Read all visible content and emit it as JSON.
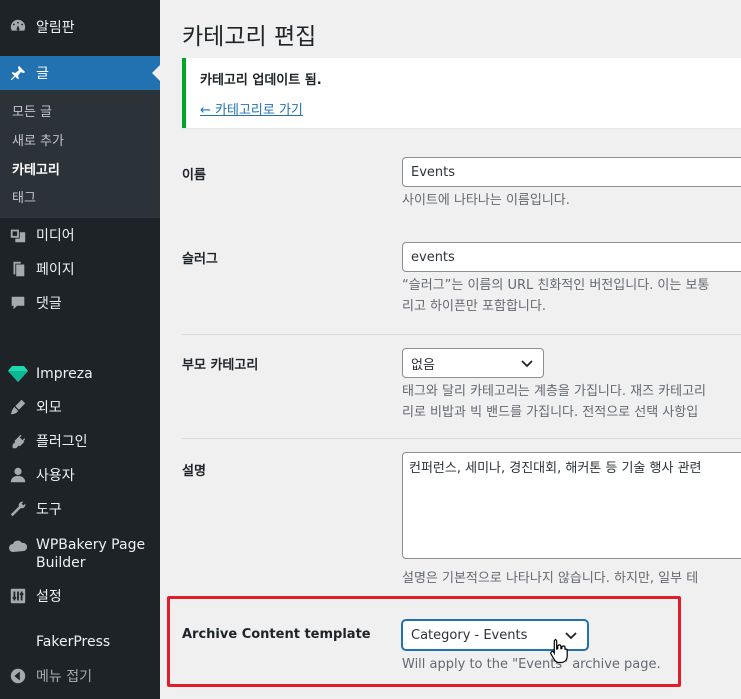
{
  "sidebar": {
    "items": [
      {
        "label": "알림판",
        "icon": "dashboard-icon"
      },
      {
        "label": "글",
        "icon": "pushpin-icon",
        "active": true
      },
      {
        "label": "미디어",
        "icon": "media-icon"
      },
      {
        "label": "페이지",
        "icon": "page-icon"
      },
      {
        "label": "댓글",
        "icon": "comment-icon"
      },
      {
        "label": "Impreza",
        "icon": "diamond-icon"
      },
      {
        "label": "외모",
        "icon": "brush-icon"
      },
      {
        "label": "플러그인",
        "icon": "plugin-icon"
      },
      {
        "label": "사용자",
        "icon": "user-icon"
      },
      {
        "label": "도구",
        "icon": "wrench-icon"
      },
      {
        "label": "WPBakery Page",
        "label2": "Builder",
        "icon": "cloud-icon"
      },
      {
        "label": "설정",
        "icon": "settings-icon"
      },
      {
        "label": "FakerPress",
        "icon": ""
      },
      {
        "label": "메뉴 접기",
        "icon": "collapse-icon"
      }
    ],
    "submenu": [
      "모든 글",
      "새로 추가",
      "카테고리",
      "태그"
    ]
  },
  "page": {
    "title": "카테고리 편집",
    "notice": {
      "message": "카테고리 업데이트 됨.",
      "back_link": "← 카테고리로 가기"
    }
  },
  "form": {
    "name": {
      "label": "이름",
      "value": "Events",
      "desc": "사이트에 나타나는 이름입니다."
    },
    "slug": {
      "label": "슬러그",
      "value": "events",
      "desc1": "“슬러그”는 이름의 URL 친화적인 버전입니다. 이는 보통",
      "desc2": "리고 하이픈만 포함합니다."
    },
    "parent": {
      "label": "부모 카테고리",
      "value": "없음",
      "desc1": "태그와 달리 카테고리는 계층을 가집니다. 재즈 카테고리",
      "desc2": "리로 비밥과 빅 밴드를 가집니다. 전적으로 선택 사항입"
    },
    "description": {
      "label": "설명",
      "value": "컨퍼런스, 세미나, 경진대회, 해커톤 등 기술 행사 관련",
      "desc": "설명은 기본적으로 나타나지 않습니다. 하지만, 일부 테"
    },
    "archive": {
      "label": "Archive Content template",
      "value": "Category - Events",
      "desc": "Will apply to the \"Events\" archive page."
    }
  },
  "colors": {
    "accent": "#2271b1",
    "success": "#00a32a",
    "highlight": "#e11d2a",
    "sidebar_bg": "#1d2327"
  }
}
